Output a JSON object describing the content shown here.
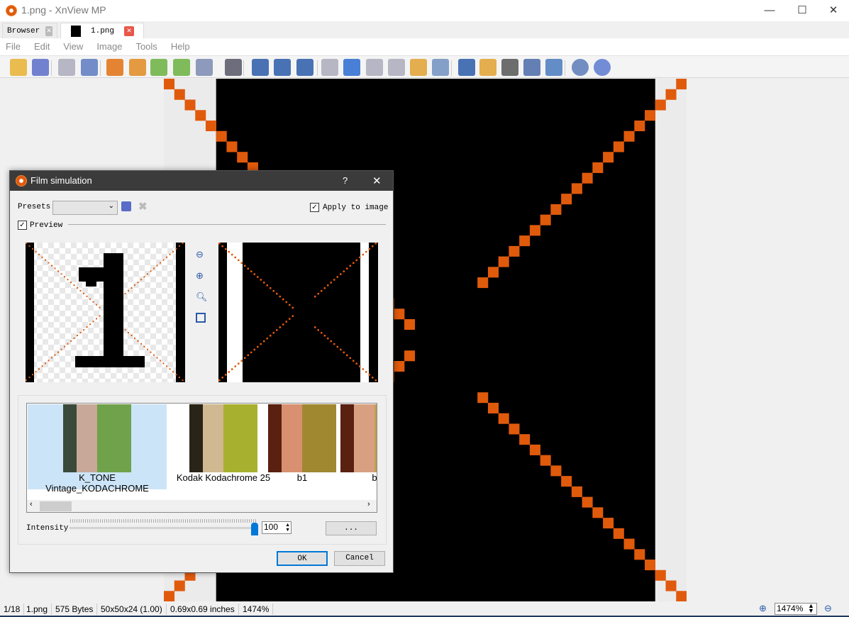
{
  "window": {
    "title": "1.png - XnView MP",
    "minimize": "—",
    "maximize": "☐",
    "close": "✕"
  },
  "tabs": [
    {
      "label": "Browser",
      "close": "✕"
    },
    {
      "label": "1.png",
      "close": "✕"
    }
  ],
  "menu": [
    "File",
    "Edit",
    "View",
    "Image",
    "Tools",
    "Help"
  ],
  "toolbar_icons": [
    "open-browser-icon",
    "save-icon",
    "undo-icon",
    "redo-icon",
    "crop-icon",
    "resize-icon",
    "rotate-left-icon",
    "rotate-right-icon",
    "adjust-colors-icon",
    "levels-icon",
    "zoom-in-icon",
    "zoom-1to1-icon",
    "zoom-out-icon",
    "previous-icon",
    "next-icon",
    "first-icon",
    "last-icon",
    "slideshow-icon",
    "info-icon",
    "fullscreen-icon",
    "edit-text-icon",
    "print-icon",
    "scan-icon",
    "capture-icon",
    "settings-icon",
    "help-icon"
  ],
  "statusbar": {
    "index": "1/18",
    "filename": "1.png",
    "size": "575 Bytes",
    "dimensions": "50x50x24 (1.00)",
    "inches": "0.69x0.69 inches",
    "zoom": "1474%",
    "zoom_field": "1474%"
  },
  "dialog": {
    "title": "Film simulation",
    "help": "?",
    "close": "✕",
    "presets_label": "Presets:",
    "presets_value": "",
    "apply_label": "Apply to image",
    "apply_checked": true,
    "preview_label": "Preview",
    "preview_checked": true,
    "thumbnails": [
      {
        "label": "K_TONE Vintage_KODACHROME",
        "selected": true
      },
      {
        "label": "Kodak Kodachrome 25"
      },
      {
        "label": "b1"
      },
      {
        "label": "b"
      }
    ],
    "intensity_label": "Intensity",
    "intensity_value": "100",
    "intensity_percent": 100,
    "more_button": "...",
    "ok": "OK",
    "cancel": "Cancel"
  },
  "colors": {
    "accent": "#e05a0c",
    "dialog_title_bg": "#3b3b3b",
    "selection": "#cce4f7",
    "slider": "#0078d7"
  }
}
